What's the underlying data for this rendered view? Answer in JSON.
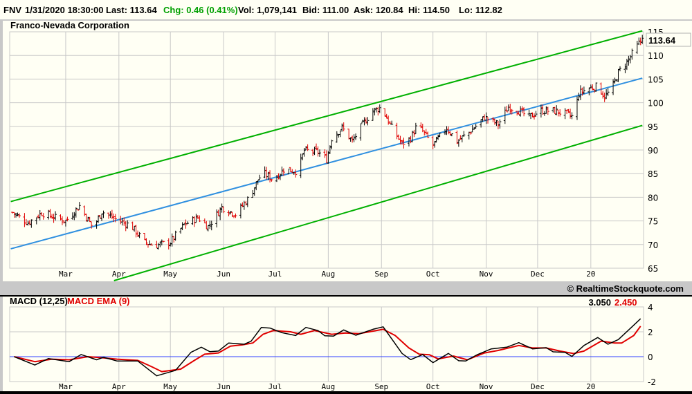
{
  "header": {
    "symbol": "FNV",
    "datetime": "1/31/2020 18:30:00",
    "last": "Last: 113.64",
    "chg": "Chg: 0.46 (0.41%)",
    "vol": "Vol: 1,079,141",
    "bid": "Bid: 111.00",
    "ask": "Ask: 120.84",
    "hi": "Hi: 114.50",
    "lo": "Lo: 112.82"
  },
  "colors": {
    "up": "#000000",
    "down": "#e00000",
    "channel": "#00b000",
    "regression": "#3090e0",
    "macd": "#000000",
    "signal": "#e00000",
    "zero": "#3040ff",
    "grid": "#c8c8c8",
    "chg": "#00a000"
  },
  "copyright": "© RealtimeStockquote.com",
  "chart_data": [
    {
      "type": "ohlc",
      "title": "Franco-Nevada Corporation",
      "last_price_label": "113.64",
      "x_unit": "days since 2019-02-01",
      "x_range": [
        -4,
        365
      ],
      "ylim": [
        65,
        115
      ],
      "y_ticks": [
        65,
        70,
        75,
        80,
        85,
        90,
        95,
        100,
        105,
        110,
        115
      ],
      "x_ticks": [
        {
          "day": 28,
          "label": "Mar"
        },
        {
          "day": 59,
          "label": "Apr"
        },
        {
          "day": 89,
          "label": "May"
        },
        {
          "day": 120,
          "label": "Jun"
        },
        {
          "day": 150,
          "label": "Jul"
        },
        {
          "day": 181,
          "label": "Aug"
        },
        {
          "day": 212,
          "label": "Sep"
        },
        {
          "day": 242,
          "label": "Oct"
        },
        {
          "day": 273,
          "label": "Nov"
        },
        {
          "day": 303,
          "label": "Dec"
        },
        {
          "day": 334,
          "label": "20"
        }
      ],
      "close_keypoints": [
        [
          -3,
          76.8
        ],
        [
          6,
          74.6
        ],
        [
          14,
          76.7
        ],
        [
          22,
          75.7
        ],
        [
          28,
          75
        ],
        [
          36,
          78.2
        ],
        [
          44,
          73.5
        ],
        [
          49,
          77
        ],
        [
          58,
          75.2
        ],
        [
          66,
          74
        ],
        [
          74,
          70.5
        ],
        [
          80,
          69.8
        ],
        [
          89,
          70.5
        ],
        [
          97,
          74.2
        ],
        [
          105,
          75.7
        ],
        [
          111,
          73.8
        ],
        [
          119,
          77.9
        ],
        [
          127,
          76.4
        ],
        [
          135,
          80
        ],
        [
          140,
          83.7
        ],
        [
          143,
          85.2
        ],
        [
          149,
          83.7
        ],
        [
          155,
          85.9
        ],
        [
          163,
          85.5
        ],
        [
          167,
          89.9
        ],
        [
          175,
          89.6
        ],
        [
          180,
          88
        ],
        [
          183,
          92.5
        ],
        [
          189,
          94.7
        ],
        [
          195,
          91.8
        ],
        [
          201,
          95.4
        ],
        [
          207,
          98.3
        ],
        [
          212,
          99
        ],
        [
          218,
          94.7
        ],
        [
          224,
          91.3
        ],
        [
          229,
          92.5
        ],
        [
          233,
          95.4
        ],
        [
          242,
          91
        ],
        [
          250,
          94.7
        ],
        [
          256,
          91.8
        ],
        [
          264,
          94
        ],
        [
          272,
          96.9
        ],
        [
          280,
          95.4
        ],
        [
          286,
          99.1
        ],
        [
          292,
          98.3
        ],
        [
          298,
          96.9
        ],
        [
          304,
          98.3
        ],
        [
          312,
          98.3
        ],
        [
          320,
          97.6
        ],
        [
          324,
          96.9
        ],
        [
          327,
          102
        ],
        [
          332,
          103
        ],
        [
          338,
          103.5
        ],
        [
          342,
          101.3
        ],
        [
          346,
          102.7
        ],
        [
          350,
          106.4
        ],
        [
          355,
          108.6
        ],
        [
          359,
          110.8
        ],
        [
          364,
          113.64
        ]
      ],
      "regression": {
        "start": [
          -4,
          69.1
        ],
        "end": [
          364,
          105.2
        ],
        "band": 10
      }
    },
    {
      "type": "line",
      "title": "MACD (12,25)",
      "signal_title": "MACD EMA (9)",
      "macd_value": "3.050",
      "signal_value": "2.450",
      "ylim": [
        -2,
        4
      ],
      "y_ticks": [
        -2,
        0,
        2,
        4
      ],
      "series": [
        {
          "name": "MACD (12,25)",
          "points": [
            [
              -2,
              0
            ],
            [
              10,
              -0.67
            ],
            [
              18,
              -0.15
            ],
            [
              30,
              -0.4
            ],
            [
              37,
              0.17
            ],
            [
              46,
              -0.25
            ],
            [
              50,
              -0.05
            ],
            [
              58,
              -0.35
            ],
            [
              70,
              -0.35
            ],
            [
              81,
              -1.54
            ],
            [
              92,
              -1.1
            ],
            [
              101,
              0.35
            ],
            [
              107,
              0.76
            ],
            [
              112,
              0.4
            ],
            [
              117,
              0.45
            ],
            [
              123,
              1.1
            ],
            [
              132,
              1.0
            ],
            [
              136,
              1.24
            ],
            [
              142,
              2.35
            ],
            [
              147,
              2.3
            ],
            [
              154,
              1.93
            ],
            [
              162,
              1.7
            ],
            [
              168,
              2.35
            ],
            [
              175,
              2.1
            ],
            [
              179,
              1.68
            ],
            [
              184,
              1.65
            ],
            [
              190,
              2.15
            ],
            [
              197,
              1.72
            ],
            [
              207,
              2.2
            ],
            [
              213,
              2.4
            ],
            [
              224,
              0.26
            ],
            [
              229,
              -0.24
            ],
            [
              236,
              0.17
            ],
            [
              242,
              -0.48
            ],
            [
              251,
              0.26
            ],
            [
              257,
              -0.33
            ],
            [
              261,
              -0.35
            ],
            [
              268,
              0.17
            ],
            [
              276,
              0.63
            ],
            [
              285,
              0.76
            ],
            [
              292,
              1.13
            ],
            [
              300,
              0.63
            ],
            [
              308,
              0.72
            ],
            [
              312,
              0.39
            ],
            [
              319,
              0.35
            ],
            [
              323,
              0.02
            ],
            [
              330,
              0.9
            ],
            [
              338,
              1.54
            ],
            [
              344,
              1.0
            ],
            [
              350,
              1.37
            ],
            [
              358,
              2.4
            ],
            [
              363,
              3.05
            ]
          ]
        },
        {
          "name": "MACD EMA (9)",
          "points": [
            [
              -2,
              0
            ],
            [
              10,
              -0.4
            ],
            [
              20,
              -0.2
            ],
            [
              30,
              -0.25
            ],
            [
              41,
              0.0
            ],
            [
              50,
              -0.1
            ],
            [
              58,
              -0.2
            ],
            [
              70,
              -0.3
            ],
            [
              78,
              -0.8
            ],
            [
              84,
              -1.2
            ],
            [
              95,
              -1.0
            ],
            [
              103,
              -0.3
            ],
            [
              109,
              0.2
            ],
            [
              117,
              0.3
            ],
            [
              124,
              0.85
            ],
            [
              131,
              0.95
            ],
            [
              137,
              1.1
            ],
            [
              143,
              1.8
            ],
            [
              149,
              2.1
            ],
            [
              159,
              2.0
            ],
            [
              165,
              1.8
            ],
            [
              173,
              2.1
            ],
            [
              183,
              1.8
            ],
            [
              191,
              1.9
            ],
            [
              199,
              1.85
            ],
            [
              205,
              2.0
            ],
            [
              213,
              2.2
            ],
            [
              220,
              1.7
            ],
            [
              228,
              0.7
            ],
            [
              234,
              0.2
            ],
            [
              240,
              0.15
            ],
            [
              245,
              -0.18
            ],
            [
              254,
              0.05
            ],
            [
              262,
              -0.25
            ],
            [
              272,
              0.3
            ],
            [
              280,
              0.5
            ],
            [
              292,
              0.9
            ],
            [
              300,
              0.7
            ],
            [
              308,
              0.7
            ],
            [
              316,
              0.45
            ],
            [
              324,
              0.25
            ],
            [
              330,
              0.45
            ],
            [
              340,
              1.25
            ],
            [
              348,
              1.1
            ],
            [
              352,
              1.1
            ],
            [
              359,
              1.7
            ],
            [
              363,
              2.45
            ]
          ]
        }
      ]
    }
  ]
}
